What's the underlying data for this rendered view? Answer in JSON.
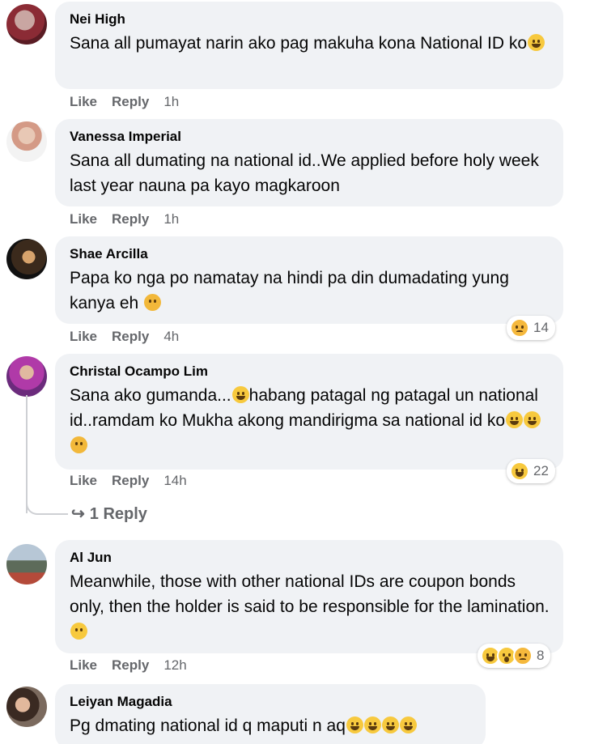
{
  "comments": [
    {
      "author": "Nei High",
      "text": "Sana all pumayat narin ako pag makuha kona National ID ko",
      "like": "Like",
      "reply": "Reply",
      "time": "1h"
    },
    {
      "author": "Vanessa Imperial",
      "text": "Sana all dumating na national id..We applied before holy week last year nauna pa kayo magkaroon",
      "like": "Like",
      "reply": "Reply",
      "time": "1h"
    },
    {
      "author": "Shae Arcilla",
      "text": "Papa ko nga po namatay na hindi pa din dumadating yung kanya eh",
      "like": "Like",
      "reply": "Reply",
      "time": "4h",
      "reaction_count": "14"
    },
    {
      "author": "Christal Ocampo Lim",
      "text_a": "Sana ako gumanda...",
      "text_b": "habang patagal ng patagal un national id..ramdam ko Mukha akong mandirigma sa national id ko",
      "like": "Like",
      "reply": "Reply",
      "time": "14h",
      "reaction_count": "22",
      "replies_link": "1 Reply"
    },
    {
      "author": "Al Jun",
      "text": "Meanwhile, those with other national IDs are coupon bonds only, then the holder is said to be responsible for the lamination.",
      "like": "Like",
      "reply": "Reply",
      "time": "12h",
      "reaction_count": "8"
    },
    {
      "author": "Leiyan Magadia",
      "text": "Pg dmating national id q maputi n aq"
    }
  ],
  "icons": {
    "reply_arrow": "reply-arrow-icon",
    "emoji": "emoji-icon"
  },
  "colors": {
    "bubble": "#f0f2f5",
    "secondary_text": "#65676b",
    "reaction_yellow": "#f7c93e"
  }
}
